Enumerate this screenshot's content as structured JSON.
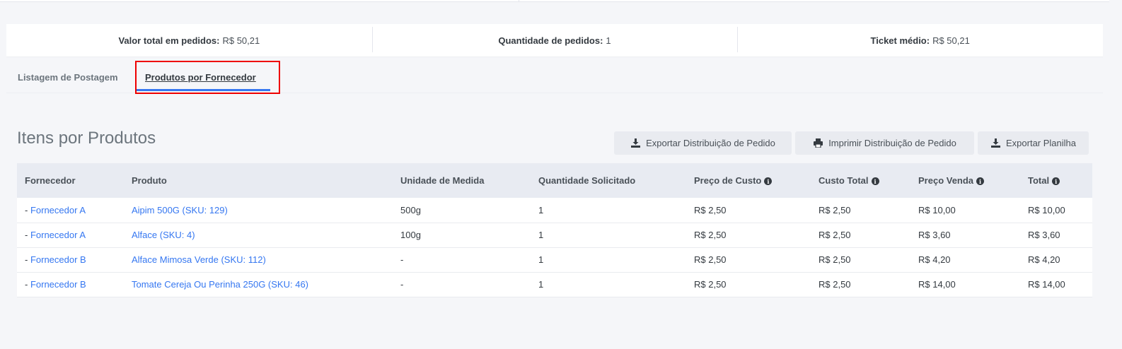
{
  "stats": [
    {
      "label": "Valor total em pedidos:",
      "value": "R$ 50,21"
    },
    {
      "label": "Quantidade de pedidos:",
      "value": "1"
    },
    {
      "label": "Ticket médio:",
      "value": "R$ 50,21"
    }
  ],
  "tabs": [
    {
      "label": "Listagem de Postagem"
    },
    {
      "label": "Produtos por Fornecedor"
    }
  ],
  "section": {
    "title": "Itens por Produtos"
  },
  "actions": {
    "export_distribution": "Exportar Distribuição de Pedido",
    "print_distribution": "Imprimir Distribuição de Pedido",
    "export_sheet": "Exportar Planilha"
  },
  "table": {
    "headers": [
      "Fornecedor",
      "Produto",
      "Unidade de Medida",
      "Quantidade Solicitado",
      "Preço de Custo",
      "Custo Total",
      "Preço Venda",
      "Total"
    ],
    "rows": [
      {
        "prefix": "- ",
        "supplier": "Fornecedor A",
        "product": "Aipim 500G (SKU: 129)",
        "unit": "500g",
        "qty": "1",
        "cost": "R$ 2,50",
        "cost_total": "R$ 2,50",
        "price": "R$ 10,00",
        "total": "R$ 10,00"
      },
      {
        "prefix": "- ",
        "supplier": "Fornecedor A",
        "product": "Alface (SKU: 4)",
        "unit": "100g",
        "qty": "1",
        "cost": "R$ 2,50",
        "cost_total": "R$ 2,50",
        "price": "R$ 3,60",
        "total": "R$ 3,60"
      },
      {
        "prefix": "- ",
        "supplier": "Fornecedor B",
        "product": "Alface Mimosa Verde (SKU: 112)",
        "unit": "-",
        "qty": "1",
        "cost": "R$ 2,50",
        "cost_total": "R$ 2,50",
        "price": "R$ 4,20",
        "total": "R$ 4,20"
      },
      {
        "prefix": "- ",
        "supplier": "Fornecedor B",
        "product": "Tomate Cereja Ou Perinha 250G (SKU: 46)",
        "unit": "-",
        "qty": "1",
        "cost": "R$ 2,50",
        "cost_total": "R$ 2,50",
        "price": "R$ 14,00",
        "total": "R$ 14,00"
      }
    ]
  },
  "icons": {
    "download": "download-icon",
    "print": "print-icon",
    "info": "info-icon"
  },
  "colors": {
    "link": "#3577f1",
    "active_tab": "#3577f1",
    "highlight": "#ee0000"
  }
}
